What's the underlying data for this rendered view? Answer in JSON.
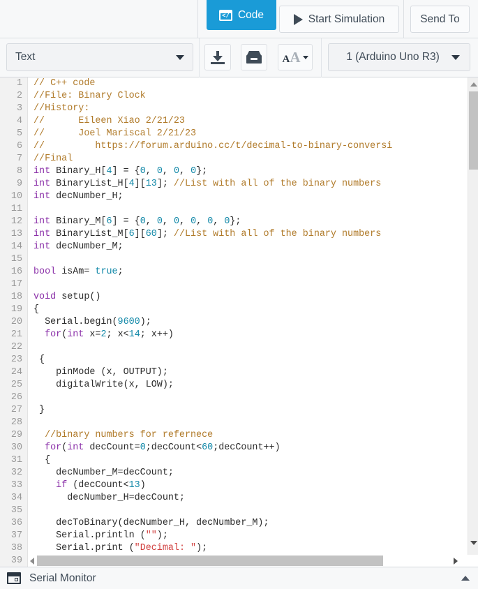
{
  "topbar": {
    "code_button": {
      "label": "Code",
      "icon": "code-window-icon",
      "active": true,
      "color": "#1a9bd7"
    },
    "start_simulation_button": {
      "label": "Start Simulation",
      "icon": "play-icon"
    },
    "send_to_button": {
      "label": "Send To"
    }
  },
  "toolbar": {
    "mode_select": {
      "value": "Text",
      "icon": "chevron-down-icon"
    },
    "download_button": {
      "icon": "download-icon"
    },
    "library_button": {
      "icon": "library-icon"
    },
    "font_size_button": {
      "icon": "font-size-icon",
      "label_small": "A",
      "label_big": "A"
    },
    "board_select": {
      "value": "1 (Arduino Uno R3)",
      "icon": "chevron-down-icon"
    }
  },
  "editor": {
    "language": "cpp",
    "first_visible_line": 1,
    "last_visible_line": 39,
    "syntax_colors": {
      "comment": "#b07a29",
      "keyword": "#8a2fa8",
      "number": "#1188a8",
      "string": "#d1403f",
      "plain": "#2b2b2b",
      "gutter": "#999999"
    },
    "lines": [
      {
        "n": 1,
        "tokens": [
          {
            "t": "// C++ code",
            "c": "cmt"
          }
        ]
      },
      {
        "n": 2,
        "tokens": [
          {
            "t": "//File: Binary Clock",
            "c": "cmt"
          }
        ]
      },
      {
        "n": 3,
        "tokens": [
          {
            "t": "//History:",
            "c": "cmt"
          }
        ]
      },
      {
        "n": 4,
        "tokens": [
          {
            "t": "//      Eileen Xiao 2/21/23",
            "c": "cmt"
          }
        ]
      },
      {
        "n": 5,
        "tokens": [
          {
            "t": "//      Joel Mariscal 2/21/23",
            "c": "cmt"
          }
        ]
      },
      {
        "n": 6,
        "tokens": [
          {
            "t": "//         https://forum.arduino.cc/t/decimal-to-binary-conversi",
            "c": "cmt"
          }
        ]
      },
      {
        "n": 7,
        "tokens": [
          {
            "t": "//Final",
            "c": "cmt"
          }
        ]
      },
      {
        "n": 8,
        "tokens": [
          {
            "t": "int",
            "c": "kw"
          },
          {
            "t": " Binary_H[",
            "c": ""
          },
          {
            "t": "4",
            "c": "num"
          },
          {
            "t": "] = {",
            "c": ""
          },
          {
            "t": "0",
            "c": "num"
          },
          {
            "t": ", ",
            "c": ""
          },
          {
            "t": "0",
            "c": "num"
          },
          {
            "t": ", ",
            "c": ""
          },
          {
            "t": "0",
            "c": "num"
          },
          {
            "t": ", ",
            "c": ""
          },
          {
            "t": "0",
            "c": "num"
          },
          {
            "t": "};",
            "c": ""
          }
        ]
      },
      {
        "n": 9,
        "tokens": [
          {
            "t": "int",
            "c": "kw"
          },
          {
            "t": " BinaryList_H[",
            "c": ""
          },
          {
            "t": "4",
            "c": "num"
          },
          {
            "t": "][",
            "c": ""
          },
          {
            "t": "13",
            "c": "num"
          },
          {
            "t": "]; ",
            "c": ""
          },
          {
            "t": "//List with all of the binary numbers",
            "c": "cmt"
          }
        ]
      },
      {
        "n": 10,
        "tokens": [
          {
            "t": "int",
            "c": "kw"
          },
          {
            "t": " decNumber_H;",
            "c": ""
          }
        ]
      },
      {
        "n": 11,
        "tokens": [
          {
            "t": "",
            "c": ""
          }
        ]
      },
      {
        "n": 12,
        "tokens": [
          {
            "t": "int",
            "c": "kw"
          },
          {
            "t": " Binary_M[",
            "c": ""
          },
          {
            "t": "6",
            "c": "num"
          },
          {
            "t": "] = {",
            "c": ""
          },
          {
            "t": "0",
            "c": "num"
          },
          {
            "t": ", ",
            "c": ""
          },
          {
            "t": "0",
            "c": "num"
          },
          {
            "t": ", ",
            "c": ""
          },
          {
            "t": "0",
            "c": "num"
          },
          {
            "t": ", ",
            "c": ""
          },
          {
            "t": "0",
            "c": "num"
          },
          {
            "t": ", ",
            "c": ""
          },
          {
            "t": "0",
            "c": "num"
          },
          {
            "t": ", ",
            "c": ""
          },
          {
            "t": "0",
            "c": "num"
          },
          {
            "t": "};",
            "c": ""
          }
        ]
      },
      {
        "n": 13,
        "tokens": [
          {
            "t": "int",
            "c": "kw"
          },
          {
            "t": " BinaryList_M[",
            "c": ""
          },
          {
            "t": "6",
            "c": "num"
          },
          {
            "t": "][",
            "c": ""
          },
          {
            "t": "60",
            "c": "num"
          },
          {
            "t": "]; ",
            "c": ""
          },
          {
            "t": "//List with all of the binary numbers",
            "c": "cmt"
          }
        ]
      },
      {
        "n": 14,
        "tokens": [
          {
            "t": "int",
            "c": "kw"
          },
          {
            "t": " decNumber_M;",
            "c": ""
          }
        ]
      },
      {
        "n": 15,
        "tokens": [
          {
            "t": "",
            "c": ""
          }
        ]
      },
      {
        "n": 16,
        "tokens": [
          {
            "t": "bool",
            "c": "kw"
          },
          {
            "t": " isAm= ",
            "c": ""
          },
          {
            "t": "true",
            "c": "num"
          },
          {
            "t": ";",
            "c": ""
          }
        ]
      },
      {
        "n": 17,
        "tokens": [
          {
            "t": "",
            "c": ""
          }
        ]
      },
      {
        "n": 18,
        "tokens": [
          {
            "t": "void",
            "c": "kw"
          },
          {
            "t": " setup()",
            "c": ""
          }
        ]
      },
      {
        "n": 19,
        "tokens": [
          {
            "t": "{",
            "c": ""
          }
        ]
      },
      {
        "n": 20,
        "tokens": [
          {
            "t": "  Serial.begin(",
            "c": ""
          },
          {
            "t": "9600",
            "c": "num"
          },
          {
            "t": ");",
            "c": ""
          }
        ]
      },
      {
        "n": 21,
        "tokens": [
          {
            "t": "  ",
            "c": ""
          },
          {
            "t": "for",
            "c": "kw"
          },
          {
            "t": "(",
            "c": ""
          },
          {
            "t": "int",
            "c": "kw"
          },
          {
            "t": " x=",
            "c": ""
          },
          {
            "t": "2",
            "c": "num"
          },
          {
            "t": "; x<",
            "c": ""
          },
          {
            "t": "14",
            "c": "num"
          },
          {
            "t": "; x++)",
            "c": ""
          }
        ]
      },
      {
        "n": 22,
        "tokens": [
          {
            "t": "",
            "c": ""
          }
        ]
      },
      {
        "n": 23,
        "tokens": [
          {
            "t": " {",
            "c": ""
          }
        ]
      },
      {
        "n": 24,
        "tokens": [
          {
            "t": "    pinMode (x, OUTPUT);",
            "c": ""
          }
        ]
      },
      {
        "n": 25,
        "tokens": [
          {
            "t": "    digitalWrite(x, LOW);",
            "c": ""
          }
        ]
      },
      {
        "n": 26,
        "tokens": [
          {
            "t": "",
            "c": ""
          }
        ]
      },
      {
        "n": 27,
        "tokens": [
          {
            "t": " }",
            "c": ""
          }
        ]
      },
      {
        "n": 28,
        "tokens": [
          {
            "t": "",
            "c": ""
          }
        ]
      },
      {
        "n": 29,
        "tokens": [
          {
            "t": "  ",
            "c": ""
          },
          {
            "t": "//binary numbers for refernece",
            "c": "cmt"
          }
        ]
      },
      {
        "n": 30,
        "tokens": [
          {
            "t": "  ",
            "c": ""
          },
          {
            "t": "for",
            "c": "kw"
          },
          {
            "t": "(",
            "c": ""
          },
          {
            "t": "int",
            "c": "kw"
          },
          {
            "t": " decCount=",
            "c": ""
          },
          {
            "t": "0",
            "c": "num"
          },
          {
            "t": ";decCount<",
            "c": ""
          },
          {
            "t": "60",
            "c": "num"
          },
          {
            "t": ";decCount++)",
            "c": ""
          }
        ]
      },
      {
        "n": 31,
        "tokens": [
          {
            "t": "  {",
            "c": ""
          }
        ]
      },
      {
        "n": 32,
        "tokens": [
          {
            "t": "    decNumber_M=decCount;",
            "c": ""
          }
        ]
      },
      {
        "n": 33,
        "tokens": [
          {
            "t": "    ",
            "c": ""
          },
          {
            "t": "if",
            "c": "kw"
          },
          {
            "t": " (decCount<",
            "c": ""
          },
          {
            "t": "13",
            "c": "num"
          },
          {
            "t": ")",
            "c": ""
          }
        ]
      },
      {
        "n": 34,
        "tokens": [
          {
            "t": "      decNumber_H=decCount;",
            "c": ""
          }
        ]
      },
      {
        "n": 35,
        "tokens": [
          {
            "t": "",
            "c": ""
          }
        ]
      },
      {
        "n": 36,
        "tokens": [
          {
            "t": "    decToBinary(decNumber_H, decNumber_M);",
            "c": ""
          }
        ]
      },
      {
        "n": 37,
        "tokens": [
          {
            "t": "    Serial.println (",
            "c": ""
          },
          {
            "t": "\"\"",
            "c": "str"
          },
          {
            "t": ");",
            "c": ""
          }
        ]
      },
      {
        "n": 38,
        "tokens": [
          {
            "t": "    Serial.print (",
            "c": ""
          },
          {
            "t": "\"Decimal: \"",
            "c": "str"
          },
          {
            "t": ");",
            "c": ""
          }
        ]
      }
    ],
    "clipped_line_number": 39
  },
  "scrollbars": {
    "vertical": {
      "up_icon": "triangle-up-icon",
      "down_icon": "triangle-down-icon"
    },
    "horizontal": {
      "left_icon": "triangle-left-icon",
      "right_icon": "triangle-right-icon"
    }
  },
  "serial_monitor": {
    "label": "Serial Monitor",
    "icon": "serial-monitor-panel-icon",
    "expand_icon": "chevron-up-icon"
  }
}
